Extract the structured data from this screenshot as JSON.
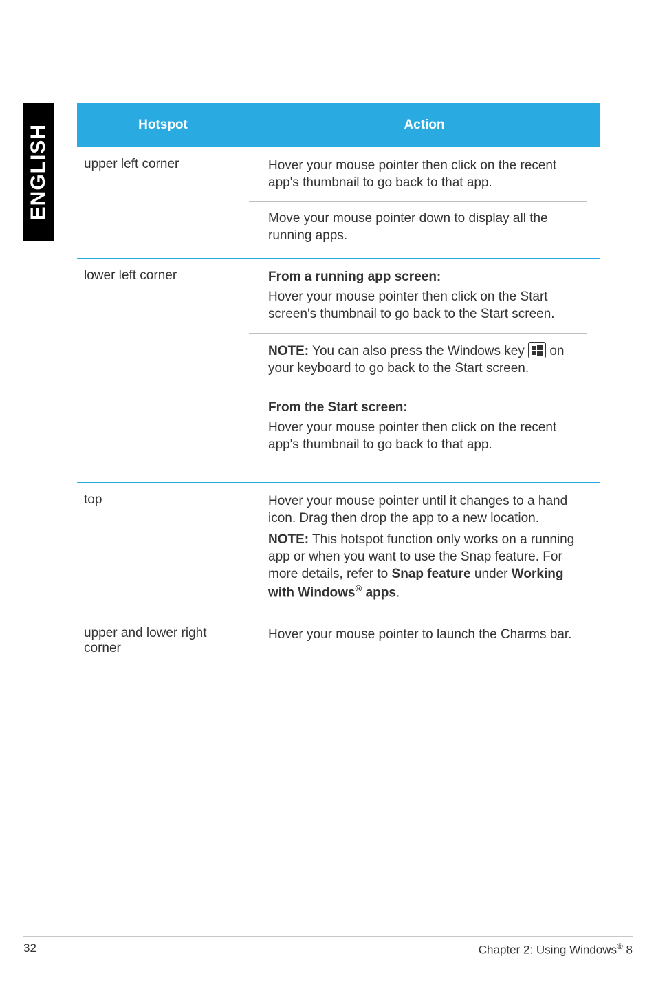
{
  "sidebar": {
    "label": "ENGLISH"
  },
  "table": {
    "head": {
      "hotspot": "Hotspot",
      "action": "Action"
    },
    "rows": {
      "upper_left": {
        "label": "upper left corner",
        "p1": "Hover your mouse pointer then click on the recent app's thumbnail to go back to that app.",
        "p2": "Move your mouse pointer down to display all the running apps."
      },
      "lower_left": {
        "label": "lower left corner",
        "sub1": "From a running app screen:",
        "p1": "Hover your mouse pointer then click on the Start screen's thumbnail to go back to the Start screen.",
        "note_prefix": "NOTE:",
        "note_a": " You can also press the Windows key ",
        "note_b": " on your keyboard to go back to the Start screen.",
        "sub2": "From the Start screen:",
        "p2": "Hover your mouse pointer then click on the recent app's thumbnail to go back to that app."
      },
      "top": {
        "label": "top",
        "p1": "Hover your mouse pointer until it changes to a hand icon. Drag then drop the app to a new location.",
        "note_prefix": "NOTE:",
        "note_a": " This hotspot function only works on a running app or when you want to use the Snap feature. For more details, refer to ",
        "bold1": "Snap feature",
        "mid": " under ",
        "bold2": "Working with Windows",
        "sup": "®",
        "bold3": " apps",
        "tail": "."
      },
      "upper_lower_right": {
        "label": "upper and lower right corner",
        "p1": "Hover your mouse pointer to launch the Charms bar."
      }
    }
  },
  "footer": {
    "page": "32",
    "chapter_a": "Chapter 2: Using Windows",
    "sup": "®",
    "chapter_b": " 8"
  }
}
